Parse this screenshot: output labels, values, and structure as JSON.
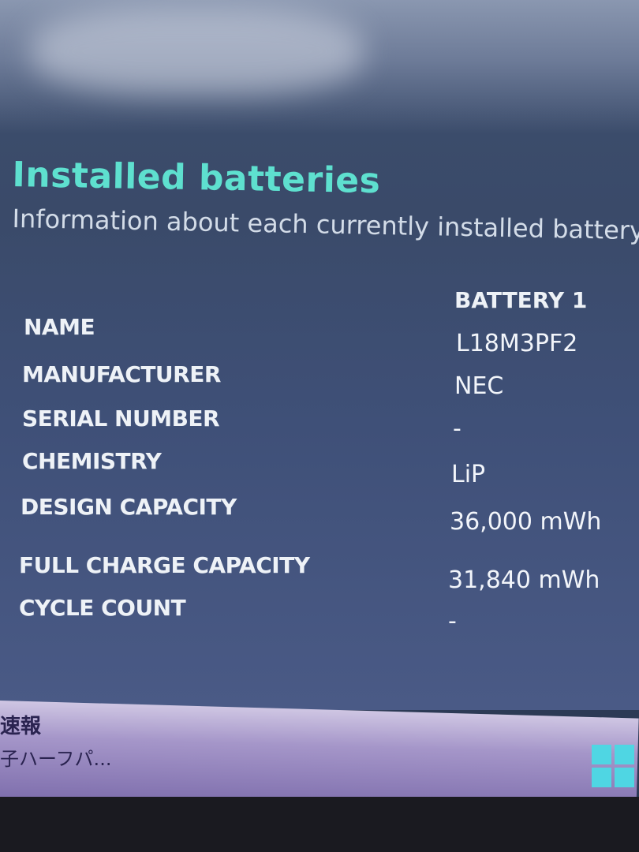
{
  "header": {
    "title": "Installed batteries",
    "subtitle": "Information about each currently installed battery"
  },
  "table": {
    "column_header": "BATTERY 1",
    "rows": [
      {
        "label": "NAME",
        "value": "L18M3PF2"
      },
      {
        "label": "MANUFACTURER",
        "value": "NEC"
      },
      {
        "label": "SERIAL NUMBER",
        "value": "-"
      },
      {
        "label": "CHEMISTRY",
        "value": "LiP"
      },
      {
        "label": "DESIGN CAPACITY",
        "value": "36,000 mWh"
      },
      {
        "label": "FULL CHARGE CAPACITY",
        "value": "31,840 mWh"
      },
      {
        "label": "CYCLE COUNT",
        "value": "-"
      }
    ]
  },
  "taskbar": {
    "news_line1": "速報",
    "news_line2": "子ハーフパ...",
    "start_icon": "windows-start-icon"
  },
  "colors": {
    "title_accent": "#5ee0cf",
    "background": "#3d4f6e",
    "start_icon": "#4fd6e3"
  }
}
